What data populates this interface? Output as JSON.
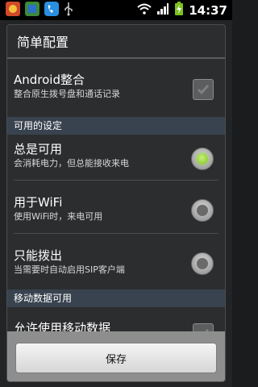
{
  "status_bar": {
    "time": "14:37"
  },
  "dialog": {
    "title": "简单配置",
    "android_integration": {
      "title": "Android整合",
      "subtitle": "整合原生拨号盘和通话记录",
      "checked": true
    },
    "available_settings_header": "可用的设定",
    "always_available": {
      "title": "总是可用",
      "subtitle": "会消耗电力，但总能接收来电",
      "selected": true
    },
    "wifi_only": {
      "title": "用于WiFi",
      "subtitle": "使用WiFi时，来电可用",
      "selected": false
    },
    "outgoing_only": {
      "title": "只能拨出",
      "subtitle": "当需要时自动启用SIP客户端",
      "selected": false
    },
    "mobile_data_header": "移动数据可用",
    "allow_mobile_data": {
      "title": "允许使用移动数据"
    },
    "save_label": "保存"
  }
}
